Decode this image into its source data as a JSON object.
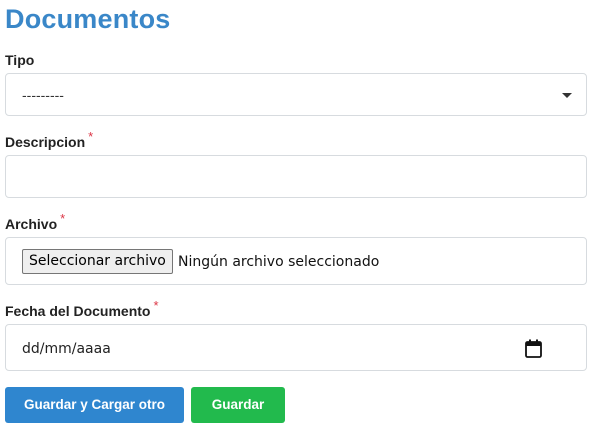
{
  "page": {
    "title": "Documentos"
  },
  "form": {
    "tipo": {
      "label": "Tipo",
      "selected": "---------"
    },
    "descripcion": {
      "label": "Descripcion",
      "required_mark": "*",
      "value": ""
    },
    "archivo": {
      "label": "Archivo",
      "required_mark": "*",
      "button_label": "Seleccionar archivo",
      "status": "Ningún archivo seleccionado"
    },
    "fecha": {
      "label": "Fecha del Documento",
      "required_mark": "*",
      "placeholder": "dd/mm/aaaa"
    }
  },
  "actions": {
    "save_and_add_label": "Guardar y Cargar otro",
    "save_label": "Guardar"
  },
  "icons": {
    "select_caret": "chevron-down-icon",
    "date_picker": "calendar-icon"
  },
  "colors": {
    "title": "#3a87c8",
    "required": "#dc3545",
    "primary_button": "#2f86cf",
    "success_button": "#22ba4d"
  }
}
